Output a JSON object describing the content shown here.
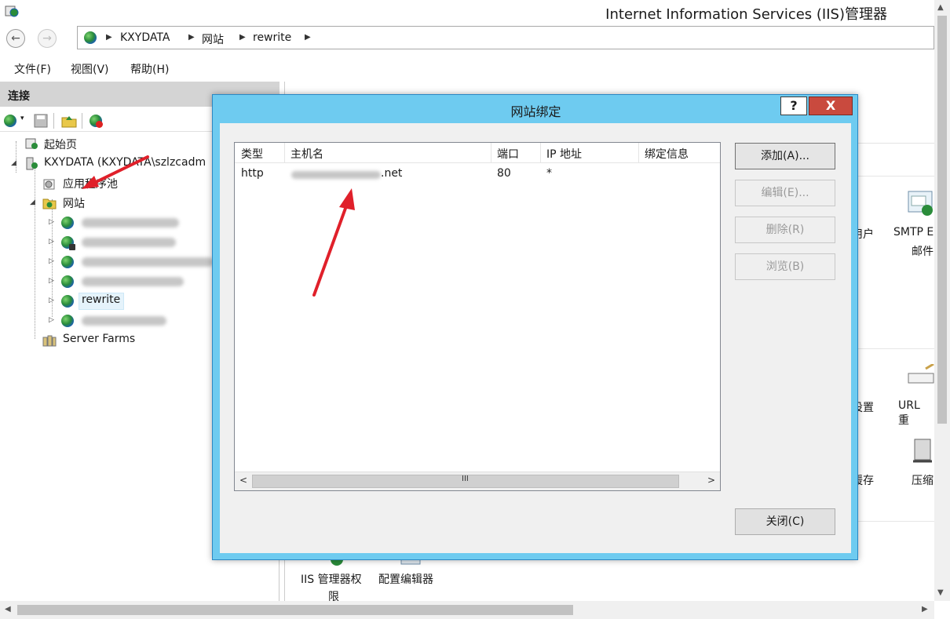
{
  "window": {
    "title": "Internet Information Services (IIS)管理器"
  },
  "address": {
    "segments": [
      "KXYDATA",
      "网站",
      "rewrite"
    ]
  },
  "menu": {
    "items": [
      "文件(F)",
      "视图(V)",
      "帮助(H)"
    ]
  },
  "connections": {
    "header": "连接",
    "tree": {
      "start_page": "起始页",
      "server": "KXYDATA (KXYDATA\\szlzcadm",
      "app_pools": "应用程序池",
      "sites": "网站",
      "selected_site": "rewrite",
      "server_farms": "Server Farms"
    }
  },
  "features": {
    "user_suffix": "用户",
    "smtp_label": "SMTP E",
    "smtp_sub": "邮件",
    "settings_suffix": "设置",
    "url_label": "URL 重",
    "cache_suffix": "缓存",
    "compress_label": "压缩",
    "iis_perm_line1": "IIS 管理器权",
    "iis_perm_line2": "限",
    "config_editor": "配置编辑器"
  },
  "dialog": {
    "title": "网站绑定",
    "help": "?",
    "close_x": "X",
    "columns": [
      "类型",
      "主机名",
      "端口",
      "IP 地址",
      "绑定信息"
    ],
    "rows": [
      {
        "type": "http",
        "host_suffix": ".net",
        "port": "80",
        "ip": "*",
        "info": ""
      }
    ],
    "scroll_grip": "III",
    "buttons": {
      "add": "添加(A)...",
      "edit": "编辑(E)...",
      "remove": "删除(R)",
      "browse": "浏览(B)",
      "close": "关闭(C)"
    }
  },
  "colors": {
    "dialog_frame": "#6ecbf0",
    "close_button": "#c94a3e",
    "arrow_red": "#e0202a"
  }
}
